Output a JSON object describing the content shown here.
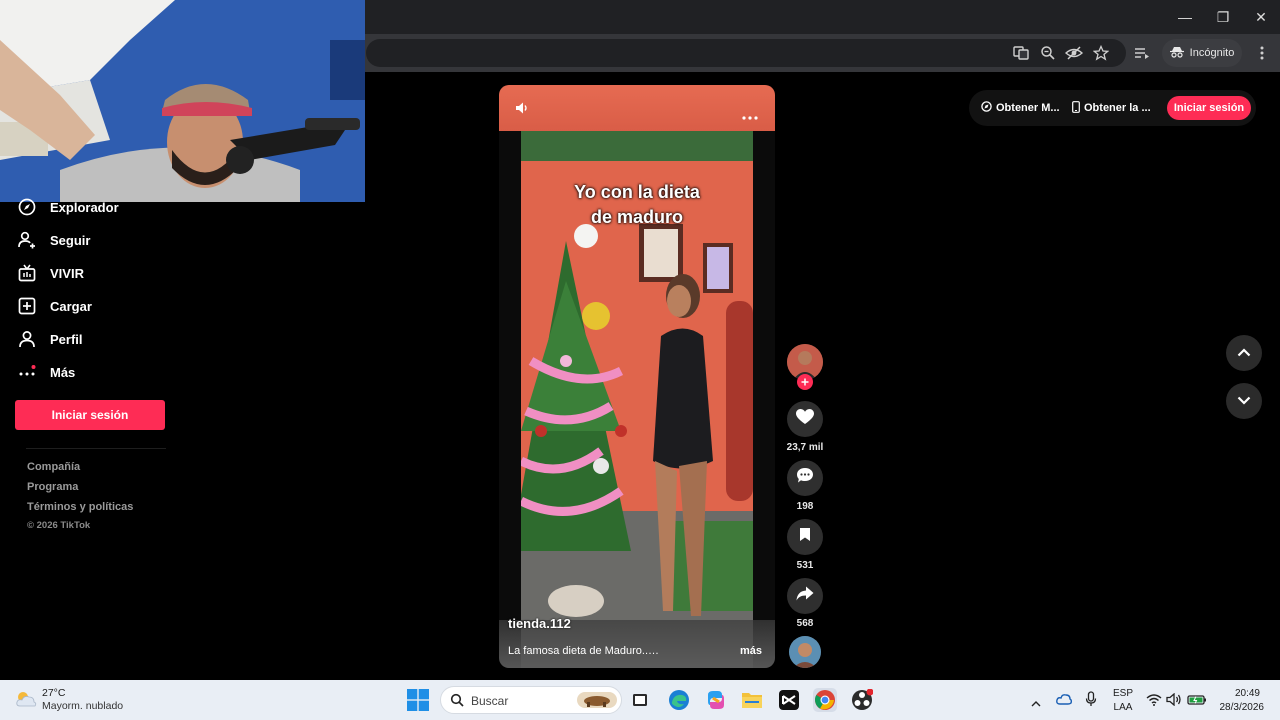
{
  "browser": {
    "incognito_label": "Incógnito"
  },
  "sidebar": {
    "items": [
      {
        "label": "Explorador",
        "icon": "compass-icon"
      },
      {
        "label": "Seguir",
        "icon": "person-plus-icon"
      },
      {
        "label": "VIVIR",
        "icon": "live-tv-icon"
      },
      {
        "label": "Cargar",
        "icon": "plus-square-icon"
      },
      {
        "label": "Perfil",
        "icon": "person-icon"
      },
      {
        "label": "Más",
        "icon": "more-dots-icon"
      }
    ],
    "login_label": "Iniciar sesión",
    "footer_links": [
      "Compañía",
      "Programa",
      "Términos y políticas"
    ],
    "copyright": "© 2026 TikTok"
  },
  "video": {
    "caption": "Yo con la dieta\nde maduro",
    "username": "tienda.112",
    "description": "La famosa dieta de Maduro..…",
    "more_label": "más"
  },
  "actions": {
    "likes": "23,7 mil",
    "comments": "198",
    "saves": "531",
    "shares": "568"
  },
  "top_bar": {
    "pill1": "Obtener M...",
    "pill2": "Obtener la ...",
    "login": "Iniciar sesión"
  },
  "taskbar": {
    "temperature": "27°C",
    "weather": "Mayorm. nublado",
    "search_placeholder": "Buscar",
    "lang1": "ESP",
    "lang2": "LAA",
    "time": "20:49",
    "date": "28/3/2026"
  },
  "colors": {
    "accent": "#fe2c55",
    "background": "#000000"
  }
}
